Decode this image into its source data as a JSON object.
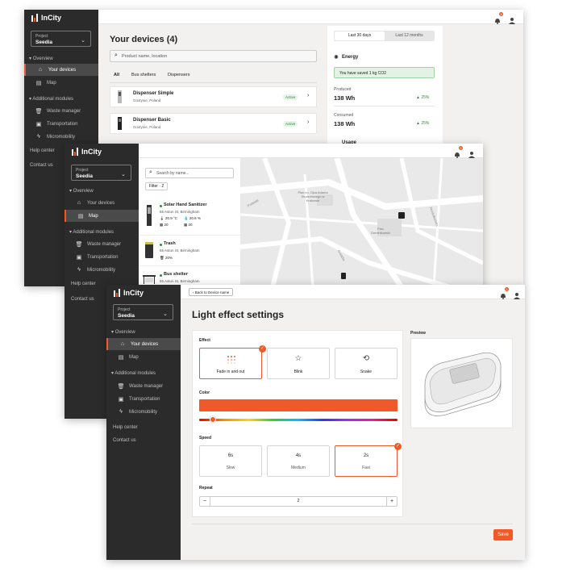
{
  "app": {
    "brand": "InCity",
    "accent": "#f05a28",
    "sidebar_bg": "#2b2b2b"
  },
  "project": {
    "label": "Project",
    "value": "Seedia"
  },
  "nav": {
    "overview": "Overview",
    "your_devices": "Your devices",
    "map": "Map",
    "additional": "Additional modules",
    "waste": "Waste manager",
    "transportation": "Transportation",
    "micromobility": "Micromobility",
    "help": "Help center",
    "contact": "Contact us"
  },
  "win1": {
    "badge": "3",
    "title": "Your devices (4)",
    "search_placeholder": "Product name, location",
    "filters": [
      "All",
      "Bus shelters",
      "Dispensers"
    ],
    "devices": [
      {
        "name": "Dispenser Simple",
        "location": "Gostynie, Poland",
        "status": "Active"
      },
      {
        "name": "Dispenser Basic",
        "location": "Gostynie, Poland",
        "status": "Active"
      }
    ],
    "tabs": [
      "Last 30 days",
      "Last 12 months"
    ],
    "energy_title": "Energy",
    "saved": "You have saved 1 kg CO2",
    "produced_label": "Produced",
    "produced_value": "138 Wh",
    "produced_change": "▲ 25%",
    "consumed_label": "Consumed",
    "consumed_value": "138 Wh",
    "consumed_change": "▲ 25%",
    "next_section": "Usage"
  },
  "win2": {
    "badge": "3",
    "search_placeholder": "Search by name...",
    "filter": "Filter · 2",
    "items": [
      {
        "name": "Solar Hand Sanitizer",
        "address": "65 Aston St, Birmingham",
        "m1": "20.9 °C",
        "m2": "20.6 %",
        "m3": "20",
        "m4": "20"
      },
      {
        "name": "Trash",
        "address": "65 Aston St, Birmingham",
        "m1": "20%"
      },
      {
        "name": "Bus shelter",
        "address": "65 Aston St, Birmingham"
      }
    ],
    "map_labels": [
      "Plac im. Ojca Adama Studzińskiego w Krakowie",
      "Plac Dominikański",
      "Podwale",
      "Grodzka",
      "Dominikańska"
    ]
  },
  "win3": {
    "badge": "2",
    "back": "Back to Device name",
    "title": "Light effect settings",
    "effect_label": "Effect",
    "effects": [
      "Fade in and out",
      "Blink",
      "Snake"
    ],
    "color_label": "Color",
    "color_value": "#f05a28",
    "hue_position": 0.07,
    "speed_label": "Speed",
    "speeds": [
      {
        "v": "6s",
        "n": "Slow"
      },
      {
        "v": "4s",
        "n": "Medium"
      },
      {
        "v": "2s",
        "n": "Fast"
      }
    ],
    "repeat_label": "Repeat",
    "repeat_value": "2",
    "minus": "−",
    "plus": "+",
    "preview_label": "Preview",
    "save": "Save"
  }
}
